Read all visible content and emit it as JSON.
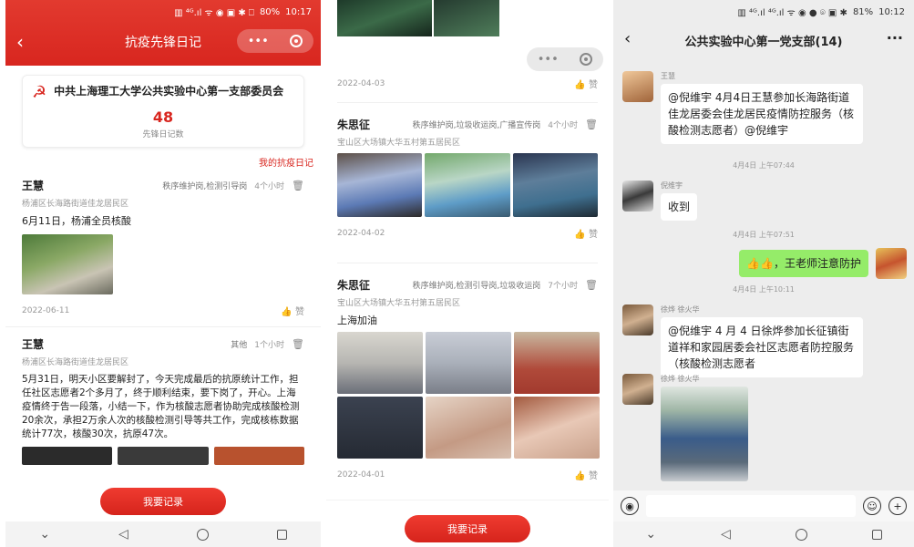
{
  "phone1": {
    "status": {
      "icons": "▥ ⁴ᴳ.ıl ᯤ ◉ ▣ ✱ ⎕",
      "battery": "80%",
      "time": "10:17"
    },
    "title": "抗疫先锋日记",
    "org_name": "中共上海理工大学公共实验中心第一支部委员会",
    "diary_count": "48",
    "diary_count_label": "先锋日记数",
    "my_link": "我的抗疫日记",
    "posts": [
      {
        "name": "王慧",
        "tags": "秩序维护岗,检测引导岗",
        "time": "4个小时",
        "address": "杨浦区长海路街道佳龙居民区",
        "text": "6月11日，杨浦全员核酸",
        "date": "2022-06-11",
        "like": "赞"
      },
      {
        "name": "王慧",
        "tags": "其他",
        "time": "1个小时",
        "address": "杨浦区长海路街道佳龙居民区",
        "text": "5月31日，明天小区要解封了，今天完成最后的抗原统计工作，担任社区志愿者2个多月了，终于顺利结束，要下岗了，开心。上海疫情终于告一段落，小结一下，作为核酸志愿者协助完成核酸检测20余次，承担2万余人次的核酸检测引导等共工作，完成核栋数据统计77次，核酸30次，抗原47次。"
      }
    ],
    "record_button": "我要记录"
  },
  "phone2": {
    "posts": [
      {
        "date": "2022-04-03",
        "like": "赞"
      },
      {
        "name": "朱思征",
        "tags": "秩序维护岗,垃圾收运岗,广播宣传岗",
        "time": "4个小时",
        "address": "宝山区大场镇大华五村第五居民区",
        "date": "2022-04-02",
        "like": "赞"
      },
      {
        "name": "朱思征",
        "tags": "秩序维护岗,检测引导岗,垃圾收运岗",
        "time": "7个小时",
        "address": "宝山区大场镇大华五村第五居民区",
        "text": "上海加油",
        "date": "2022-04-01",
        "like": "赞"
      }
    ],
    "record_button": "我要记录"
  },
  "phone3": {
    "status": {
      "icons": "▥ ⁴ᴳ.ıl ⁴ᴳ.ıl ᯤ ◉ ● ⌾ ▣ ✱",
      "battery": "81%",
      "time": "10:12"
    },
    "title": "公共实验中心第一党支部(14)",
    "messages": [
      {
        "sender": "王慧",
        "text": "@倪维宇  4月4日王慧参加长海路街道佳龙居委会佳龙居民疫情防控服务（核酸检测志愿者）@倪维宇"
      },
      {
        "time": "4月4日 上午07:44"
      },
      {
        "sender": "倪维宇",
        "text": "收到"
      },
      {
        "time": "4月4日 上午07:51"
      },
      {
        "text": "👍👍，王老师注意防护"
      },
      {
        "time": "4月4日 上午10:11"
      },
      {
        "sender": "徐烨 徐火华",
        "text": "@倪维宇  4 月 4 日徐烨参加长征镇街道祥和家园居委会社区志愿者防控服务（核酸检测志愿者"
      },
      {
        "sender": "徐烨 徐火华"
      }
    ]
  },
  "colors": {
    "accent": "#d8261f",
    "chat_green": "#95ec69",
    "chat_bg": "#ededed"
  }
}
